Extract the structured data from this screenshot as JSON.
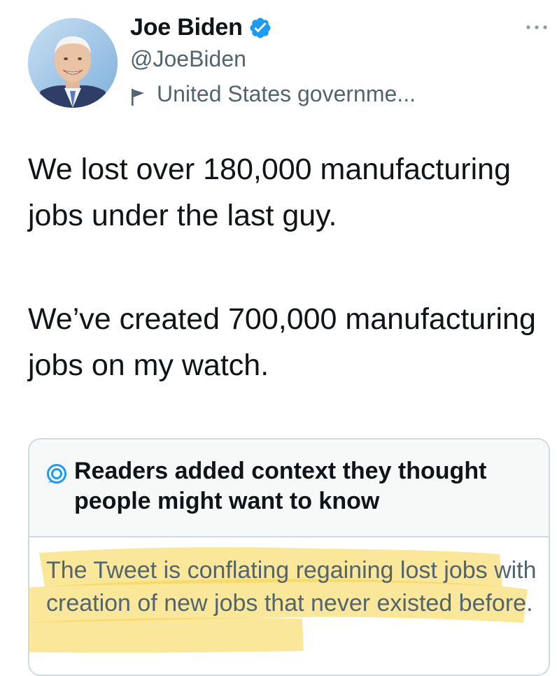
{
  "author": {
    "display_name": "Joe Biden",
    "handle": "@JoeBiden",
    "label": "United States governme...",
    "verified": true,
    "verified_color": "#1d9bf0"
  },
  "tweet": {
    "paragraph_1": "We lost over 180,000 manufacturing jobs under the last guy.",
    "paragraph_2": "We’ve created 700,000 manufacturing jobs on my watch."
  },
  "note": {
    "title": "Readers added context they thought people might want to know",
    "body": "The Tweet is conflating regaining lost jobs with creation of new jobs that never existed before.",
    "highlight_color": "#f6d346"
  },
  "icons": {
    "verified": "verified-badge-icon",
    "label": "flag-icon",
    "more": "more-options-icon",
    "note": "community-note-icon"
  },
  "colors": {
    "text_primary": "#0f1419",
    "text_secondary": "#536471",
    "border": "#cfd9de",
    "note_header_bg": "#f7f9f9",
    "accent": "#1d9bf0"
  }
}
